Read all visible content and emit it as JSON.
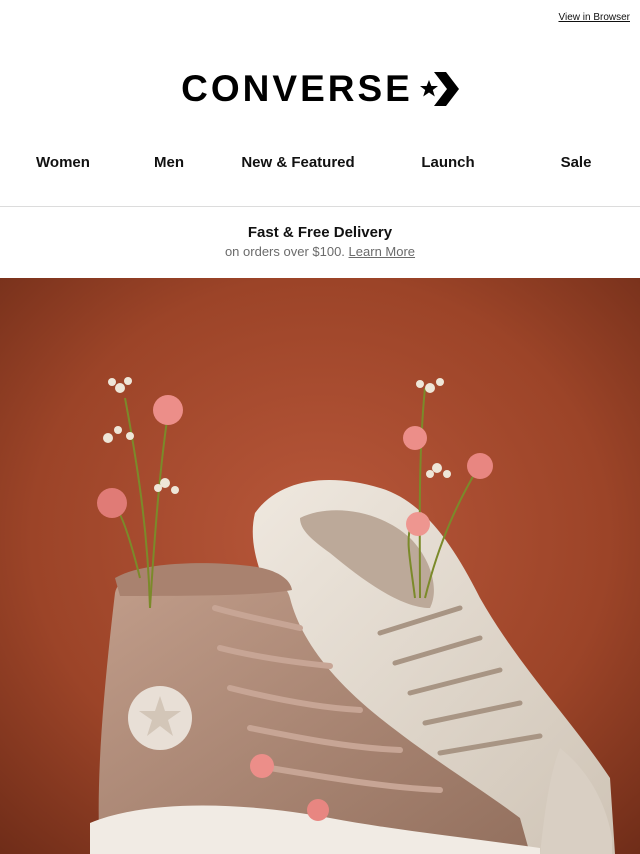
{
  "top": {
    "view_in_browser": "View in Browser"
  },
  "brand": {
    "name": "CONVERSE",
    "logo_icon": "star-chevron-icon"
  },
  "nav": {
    "items": [
      {
        "label": "Women"
      },
      {
        "label": "Men"
      },
      {
        "label": "New & Featured"
      },
      {
        "label": "Launch"
      },
      {
        "label": "Sale"
      }
    ]
  },
  "promo": {
    "title": "Fast & Free Delivery",
    "subtitle": "on orders over $100.",
    "link": "Learn More"
  },
  "hero": {
    "background_color": "#a8492b",
    "shoe_left_color": "#b08a78",
    "shoe_right_color": "#e4dcd2",
    "flower_color": "#e98c86"
  }
}
